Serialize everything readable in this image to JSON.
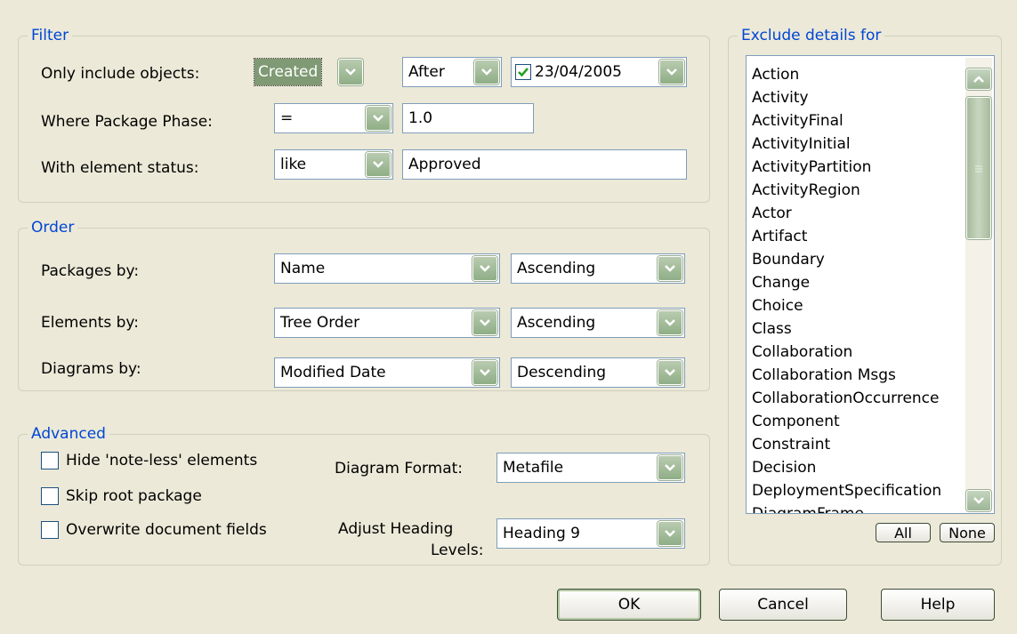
{
  "filter": {
    "title": "Filter",
    "only_include_label": "Only include objects:",
    "created_value": "Created",
    "after_value": "After",
    "date_checked": true,
    "date_value": "23/04/2005",
    "package_phase_label": "Where Package Phase:",
    "phase_operator": "=",
    "phase_value": "1.0",
    "status_label": "With element status:",
    "status_operator": "like",
    "status_value": "Approved"
  },
  "order": {
    "title": "Order",
    "packages_label": "Packages by:",
    "packages_by": "Name",
    "packages_dir": "Ascending",
    "elements_label": "Elements by:",
    "elements_by": "Tree Order",
    "elements_dir": "Ascending",
    "diagrams_label": "Diagrams by:",
    "diagrams_by": "Modified Date",
    "diagrams_dir": "Descending"
  },
  "advanced": {
    "title": "Advanced",
    "hide_noteless": "Hide 'note-less' elements",
    "skip_root": "Skip root package",
    "overwrite_fields": "Overwrite document fields",
    "diagram_format_label": "Diagram Format:",
    "diagram_format": "Metafile",
    "heading_label_1": "Adjust Heading",
    "heading_label_2": "Levels:",
    "heading_value": "Heading 9"
  },
  "exclude": {
    "title": "Exclude details for",
    "items": [
      "Action",
      "Activity",
      "ActivityFinal",
      "ActivityInitial",
      "ActivityPartition",
      "ActivityRegion",
      "Actor",
      "Artifact",
      "Boundary",
      "Change",
      "Choice",
      "Class",
      "Collaboration",
      "Collaboration Msgs",
      "CollaborationOccurrence",
      "Component",
      "Constraint",
      "Decision",
      "DeploymentSpecification",
      "DiagramFrame"
    ],
    "all_label": "All",
    "none_label": "None"
  },
  "buttons": {
    "ok": "OK",
    "cancel": "Cancel",
    "help": "Help"
  }
}
